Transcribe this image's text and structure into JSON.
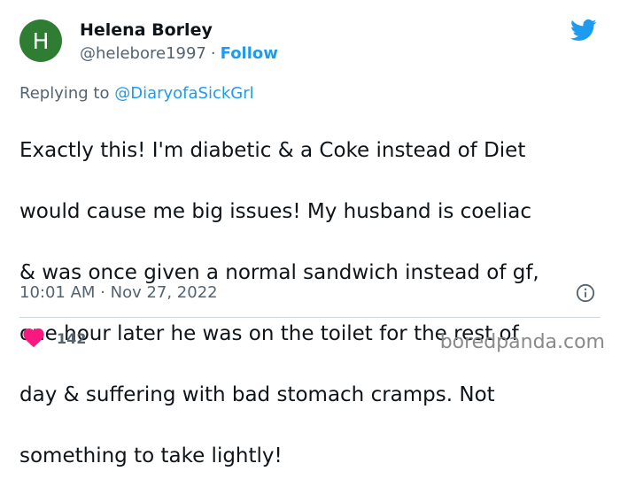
{
  "author": {
    "avatar_letter": "H",
    "avatar_color": "#2e7d32",
    "name": "Helena Borley",
    "handle": "@helebore1997",
    "separator": "·",
    "follow_label": "Follow"
  },
  "brand_icon": "twitter-bird-icon",
  "accent_color": "#1d9bf0",
  "reply": {
    "prefix": "Replying to",
    "mention": "@DiaryofaSickGrl"
  },
  "tweet": {
    "lines": [
      "Exactly this! I'm diabetic & a Coke instead of Diet",
      "would cause me big issues! My husband is coeliac",
      "& was once given a normal sandwich instead of gf,",
      "one hour later he was on the toilet for the rest of",
      "day & suffering with bad stomach cramps. Not",
      "something to take lightly!"
    ],
    "timestamp": "10:01 AM · Nov 27, 2022"
  },
  "actions": {
    "like_icon": "heart-icon",
    "like_color": "#f91880",
    "like_count": "142",
    "info_icon": "info-icon"
  },
  "watermark": "boredpanda.com"
}
